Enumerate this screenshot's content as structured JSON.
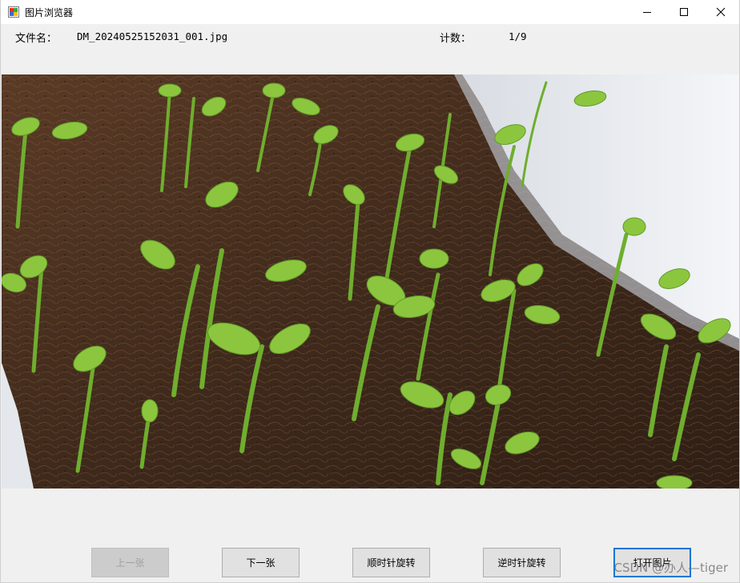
{
  "window": {
    "title": "图片浏览器",
    "minimize_icon": "minimize-icon",
    "maximize_icon": "maximize-icon",
    "close_icon": "close-icon"
  },
  "info": {
    "filename_label": "文件名：",
    "filename_value": "DM_20240525152031_001.jpg",
    "count_label": "计数：",
    "count_value": "1/9"
  },
  "image": {
    "subject": "pea seedlings in soil planter"
  },
  "buttons": {
    "prev": "上一张",
    "next": "下一张",
    "rotate_cw": "顺时针旋转",
    "rotate_ccw": "逆时针旋转",
    "open": "打开图片"
  },
  "watermark": "CSDN @办人—tiger"
}
